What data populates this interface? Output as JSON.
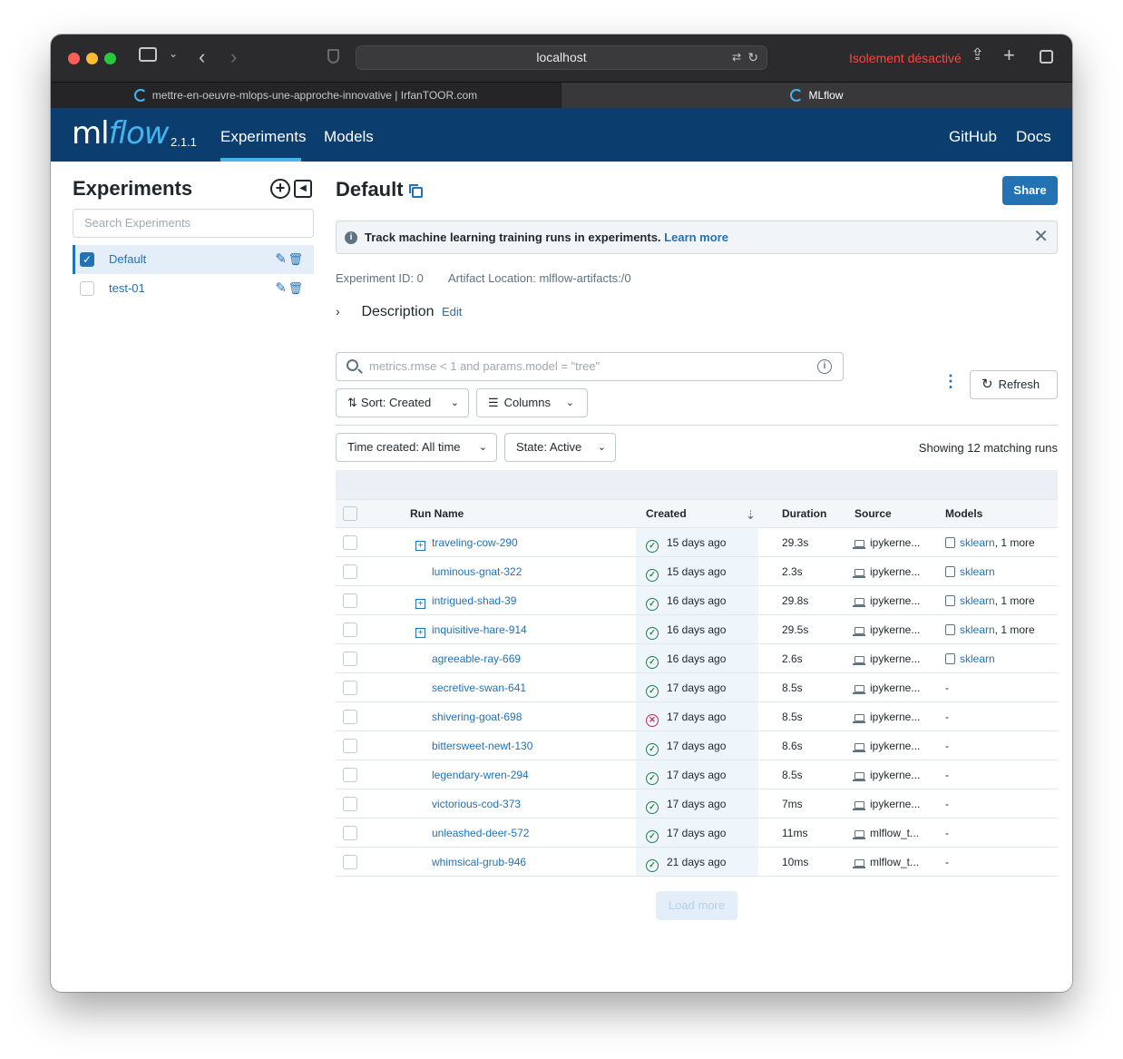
{
  "browser": {
    "url": "localhost",
    "isolation_label": "Isolement désactivé",
    "tabs": [
      {
        "title": "mettre-en-oeuvre-mlops-une-approche-innovative | IrfanTOOR.com"
      },
      {
        "title": "MLflow"
      }
    ]
  },
  "header": {
    "logo_ml": "ml",
    "logo_flow": "flow",
    "version": "2.1.1",
    "nav": [
      "Experiments",
      "Models"
    ],
    "nav_right": [
      "GitHub",
      "Docs"
    ]
  },
  "sidebar": {
    "title": "Experiments",
    "search_placeholder": "Search Experiments",
    "items": [
      {
        "label": "Default",
        "checked": true
      },
      {
        "label": "test-01",
        "checked": false
      }
    ]
  },
  "main": {
    "title": "Default",
    "share_label": "Share",
    "banner_text": "Track machine learning training runs in experiments.",
    "banner_link": "Learn more",
    "experiment_id": "Experiment ID: 0",
    "artifact_location": "Artifact Location: mlflow-artifacts:/0",
    "description_label": "Description",
    "description_edit": "Edit",
    "search_placeholder": "metrics.rmse < 1 and params.model = \"tree\"",
    "sort_label": "Sort: Created",
    "columns_label": "Columns",
    "refresh_label": "Refresh",
    "time_filter": "Time created: All time",
    "state_filter": "State: Active",
    "showing": "Showing 12 matching runs",
    "load_more": "Load more"
  },
  "table": {
    "headers": [
      "Run Name",
      "Created",
      "Duration",
      "Source",
      "Models"
    ],
    "rows": [
      {
        "name": "traveling-cow-290",
        "expandable": true,
        "status": "ok",
        "created": "15 days ago",
        "duration": "29.3s",
        "source": "ipykerne...",
        "model": "sklearn",
        "model_more": ", 1 more"
      },
      {
        "name": "luminous-gnat-322",
        "expandable": false,
        "status": "ok",
        "created": "15 days ago",
        "duration": "2.3s",
        "source": "ipykerne...",
        "model": "sklearn",
        "model_more": ""
      },
      {
        "name": "intrigued-shad-39",
        "expandable": true,
        "status": "ok",
        "created": "16 days ago",
        "duration": "29.8s",
        "source": "ipykerne...",
        "model": "sklearn",
        "model_more": ", 1 more"
      },
      {
        "name": "inquisitive-hare-914",
        "expandable": true,
        "status": "ok",
        "created": "16 days ago",
        "duration": "29.5s",
        "source": "ipykerne...",
        "model": "sklearn",
        "model_more": ", 1 more"
      },
      {
        "name": "agreeable-ray-669",
        "expandable": false,
        "status": "ok",
        "created": "16 days ago",
        "duration": "2.6s",
        "source": "ipykerne...",
        "model": "sklearn",
        "model_more": ""
      },
      {
        "name": "secretive-swan-641",
        "expandable": false,
        "status": "ok",
        "created": "17 days ago",
        "duration": "8.5s",
        "source": "ipykerne...",
        "model": "",
        "model_more": "-"
      },
      {
        "name": "shivering-goat-698",
        "expandable": false,
        "status": "fail",
        "created": "17 days ago",
        "duration": "8.5s",
        "source": "ipykerne...",
        "model": "",
        "model_more": "-"
      },
      {
        "name": "bittersweet-newt-130",
        "expandable": false,
        "status": "ok",
        "created": "17 days ago",
        "duration": "8.6s",
        "source": "ipykerne...",
        "model": "",
        "model_more": "-"
      },
      {
        "name": "legendary-wren-294",
        "expandable": false,
        "status": "ok",
        "created": "17 days ago",
        "duration": "8.5s",
        "source": "ipykerne...",
        "model": "",
        "model_more": "-"
      },
      {
        "name": "victorious-cod-373",
        "expandable": false,
        "status": "ok",
        "created": "17 days ago",
        "duration": "7ms",
        "source": "ipykerne...",
        "model": "",
        "model_more": "-"
      },
      {
        "name": "unleashed-deer-572",
        "expandable": false,
        "status": "ok",
        "created": "17 days ago",
        "duration": "11ms",
        "source": "mlflow_t...",
        "model": "",
        "model_more": "-"
      },
      {
        "name": "whimsical-grub-946",
        "expandable": false,
        "status": "ok",
        "created": "21 days ago",
        "duration": "10ms",
        "source": "mlflow_t...",
        "model": "",
        "model_more": "-"
      }
    ]
  },
  "colors": {
    "header_bg": "#0b3d6e",
    "accent": "#2272b4",
    "flow_blue": "#43b4f0",
    "success": "#277c43",
    "error": "#c82d4c"
  }
}
